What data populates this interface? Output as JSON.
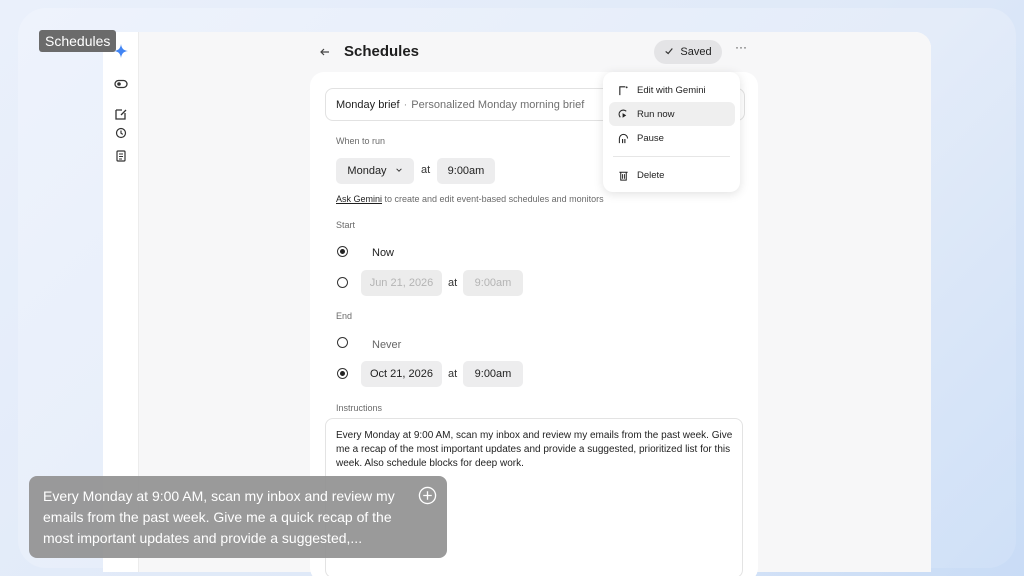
{
  "tag": "Schedules",
  "header": {
    "title": "Schedules",
    "saved_label": "Saved",
    "more_label": "···"
  },
  "schedule": {
    "name": "Monday brief",
    "separator": "·",
    "description": "Personalized Monday morning brief"
  },
  "when_to_run": {
    "label": "When to run",
    "day": "Monday",
    "at": "at",
    "time": "9:00am"
  },
  "hint": {
    "link": "Ask Gemini",
    "text": " to create and edit event-based schedules and monitors"
  },
  "start": {
    "label": "Start",
    "now_label": "Now",
    "date_placeholder": "Jun 21, 2026",
    "at": "at",
    "time_placeholder": "9:00am"
  },
  "end": {
    "label": "End",
    "never_label": "Never",
    "date": "Oct 21, 2026",
    "at": "at",
    "time": "9:00am"
  },
  "instructions": {
    "label": "Instructions",
    "text": "Every Monday at 9:00 AM, scan my inbox and review my emails from the past week. Give me a recap of the most important updates and provide a suggested, prioritized list for this week. Also schedule blocks for deep work."
  },
  "menu": {
    "items": [
      {
        "label": "Edit with Gemini",
        "icon": "edit-gemini-icon"
      },
      {
        "label": "Run now",
        "icon": "run-now-icon"
      },
      {
        "label": "Pause",
        "icon": "pause-icon"
      },
      {
        "label": "Delete",
        "icon": "trash-icon"
      }
    ]
  },
  "overlay": {
    "text": "Every Monday at 9:00 AM, scan my inbox and review my emails from the past week. Give me a quick recap of the most important updates and provide a suggested,..."
  },
  "colors": {
    "accent_blue": "#4285f4",
    "rail_bg": "#ffffff",
    "main_bg": "#f7f7f8"
  }
}
